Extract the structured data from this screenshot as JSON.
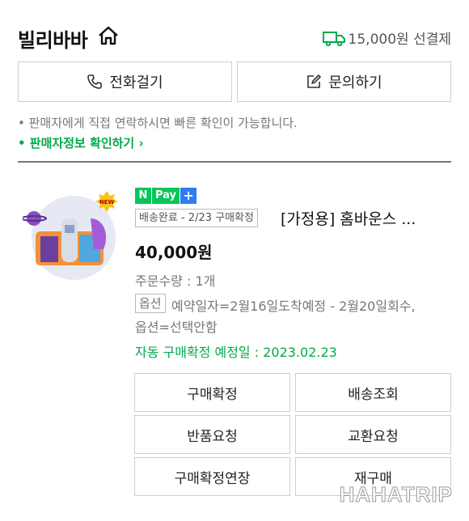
{
  "header": {
    "store_name": "빌리바바",
    "shipping_label": "15,000원 선결제"
  },
  "contact": {
    "call_label": "전화걸기",
    "inquiry_label": "문의하기"
  },
  "note": "• 판매자에게 직접 연락하시면 빠른 확인이 가능합니다.",
  "seller_info_link": "• 판매자정보 확인하기 ›",
  "product": {
    "new_badge": "NEW",
    "npay": {
      "n": "N",
      "pay": "Pay",
      "plus": "+"
    },
    "status_badge": "배송완료 - 2/23 구매확정",
    "name": "[가정용] 홈바운스 ...",
    "price": "40,000원",
    "quantity": "주문수량 : 1개",
    "option_tag": "옵션",
    "option_line1": "예약일자=2월16일도착예정 - 2월20일회수,",
    "option_line2": "옵션=선택안함",
    "auto_confirm": "자동 구매확정 예정일 : 2023.02.23"
  },
  "actions": {
    "confirm_purchase": "구매확정",
    "track_delivery": "배송조회",
    "request_return": "반품요청",
    "request_exchange": "교환요청",
    "extend_confirmation": "구매확정연장",
    "rebuy": "재구매"
  },
  "watermark": "HAHATRIP",
  "colors": {
    "green": "#03a94d",
    "npay_green": "#03c75a",
    "npay_blue": "#2f7cf6"
  }
}
